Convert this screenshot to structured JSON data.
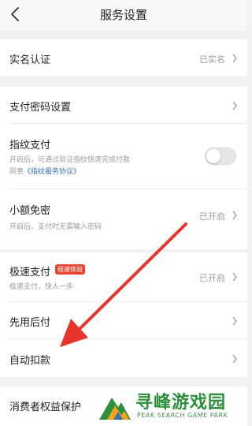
{
  "header": {
    "title": "服务设置",
    "back_icon": "chevron-left-icon"
  },
  "rows": {
    "real_name": {
      "label": "实名认证",
      "status": "已实名"
    },
    "payment_password": {
      "label": "支付密码设置"
    },
    "fingerprint": {
      "label": "指纹支付",
      "desc": "开启后，可通过验证指纹快速完成付款",
      "agree_prefix": "同意",
      "agree_link": "《指纹服务协议》",
      "toggle_on": false
    },
    "small_free": {
      "label": "小额免密",
      "status": "已开启",
      "desc": "开启后，支付时无需输入密码"
    },
    "fast_pay": {
      "label": "极速支付",
      "badge": "极速体验",
      "status": "已开启",
      "desc": "极速支付，快人一步"
    },
    "pay_later": {
      "label": "先用后付"
    },
    "auto_deduct": {
      "label": "自动扣款"
    },
    "consumer_rights": {
      "label": "消费者权益保护"
    }
  },
  "watermark": {
    "cn": "寻峰游戏园",
    "en": "PEAK SEARCH GAME PARK"
  },
  "colors": {
    "annotation_arrow": "#e8352b",
    "link": "#3a6fb0",
    "badge": "#e8432f",
    "watermark": "#2b8f3b"
  }
}
